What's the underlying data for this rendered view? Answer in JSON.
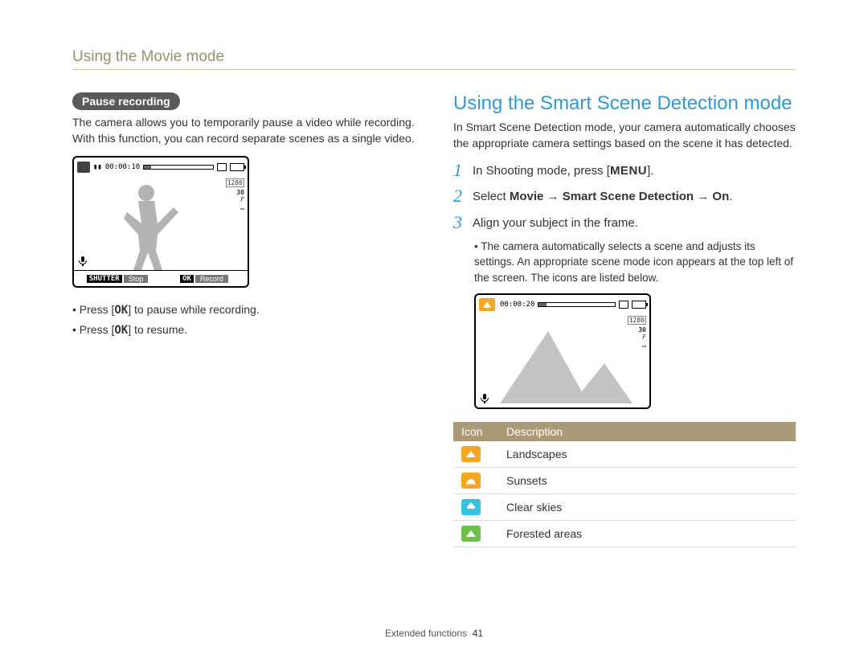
{
  "header": {
    "title": "Using the Movie mode"
  },
  "left": {
    "pill": "Pause recording",
    "intro": "The camera allows you to temporarily pause a video while recording. With this function, you can record separate scenes as a single video.",
    "screen": {
      "timer": "00:00:10",
      "resolution": "1280",
      "fps": "30",
      "shutter_label": "SHUTTER",
      "stop": "Stop",
      "ok_label": "OK",
      "record": "Record"
    },
    "bullets": {
      "b1_pre": "Press [",
      "b1_key": "OK",
      "b1_post": "] to pause while recording.",
      "b2_pre": "Press [",
      "b2_key": "OK",
      "b2_post": "] to resume."
    }
  },
  "right": {
    "title": "Using the Smart Scene Detection mode",
    "intro": "In Smart Scene Detection mode, your camera automatically chooses the appropriate camera settings based on the scene it has detected.",
    "steps": {
      "n1": "1",
      "s1_pre": "In Shooting mode, press [",
      "s1_key": "MENU",
      "s1_post": "].",
      "n2": "2",
      "s2_pre": "Select ",
      "s2_bold": "Movie → Smart Scene Detection → On",
      "s2_post": ".",
      "n3": "3",
      "s3": "Align your subject in the frame.",
      "sub": "The camera automatically selects a scene and adjusts its settings. An appropriate scene mode icon appears at the top left of the screen. The icons are listed below."
    },
    "screen": {
      "timer": "00:00:20",
      "resolution": "1280",
      "fps": "30"
    },
    "table": {
      "h1": "Icon",
      "h2": "Description",
      "rows": [
        {
          "icon": "landscape",
          "color": "#f5a623",
          "label": "Landscapes"
        },
        {
          "icon": "sunset",
          "color": "#f5a623",
          "label": "Sunsets"
        },
        {
          "icon": "sky",
          "color": "#34c4e0",
          "label": "Clear skies"
        },
        {
          "icon": "forest",
          "color": "#6fbf4b",
          "label": "Forested areas"
        }
      ]
    }
  },
  "footer": {
    "section": "Extended functions",
    "page": "41"
  }
}
